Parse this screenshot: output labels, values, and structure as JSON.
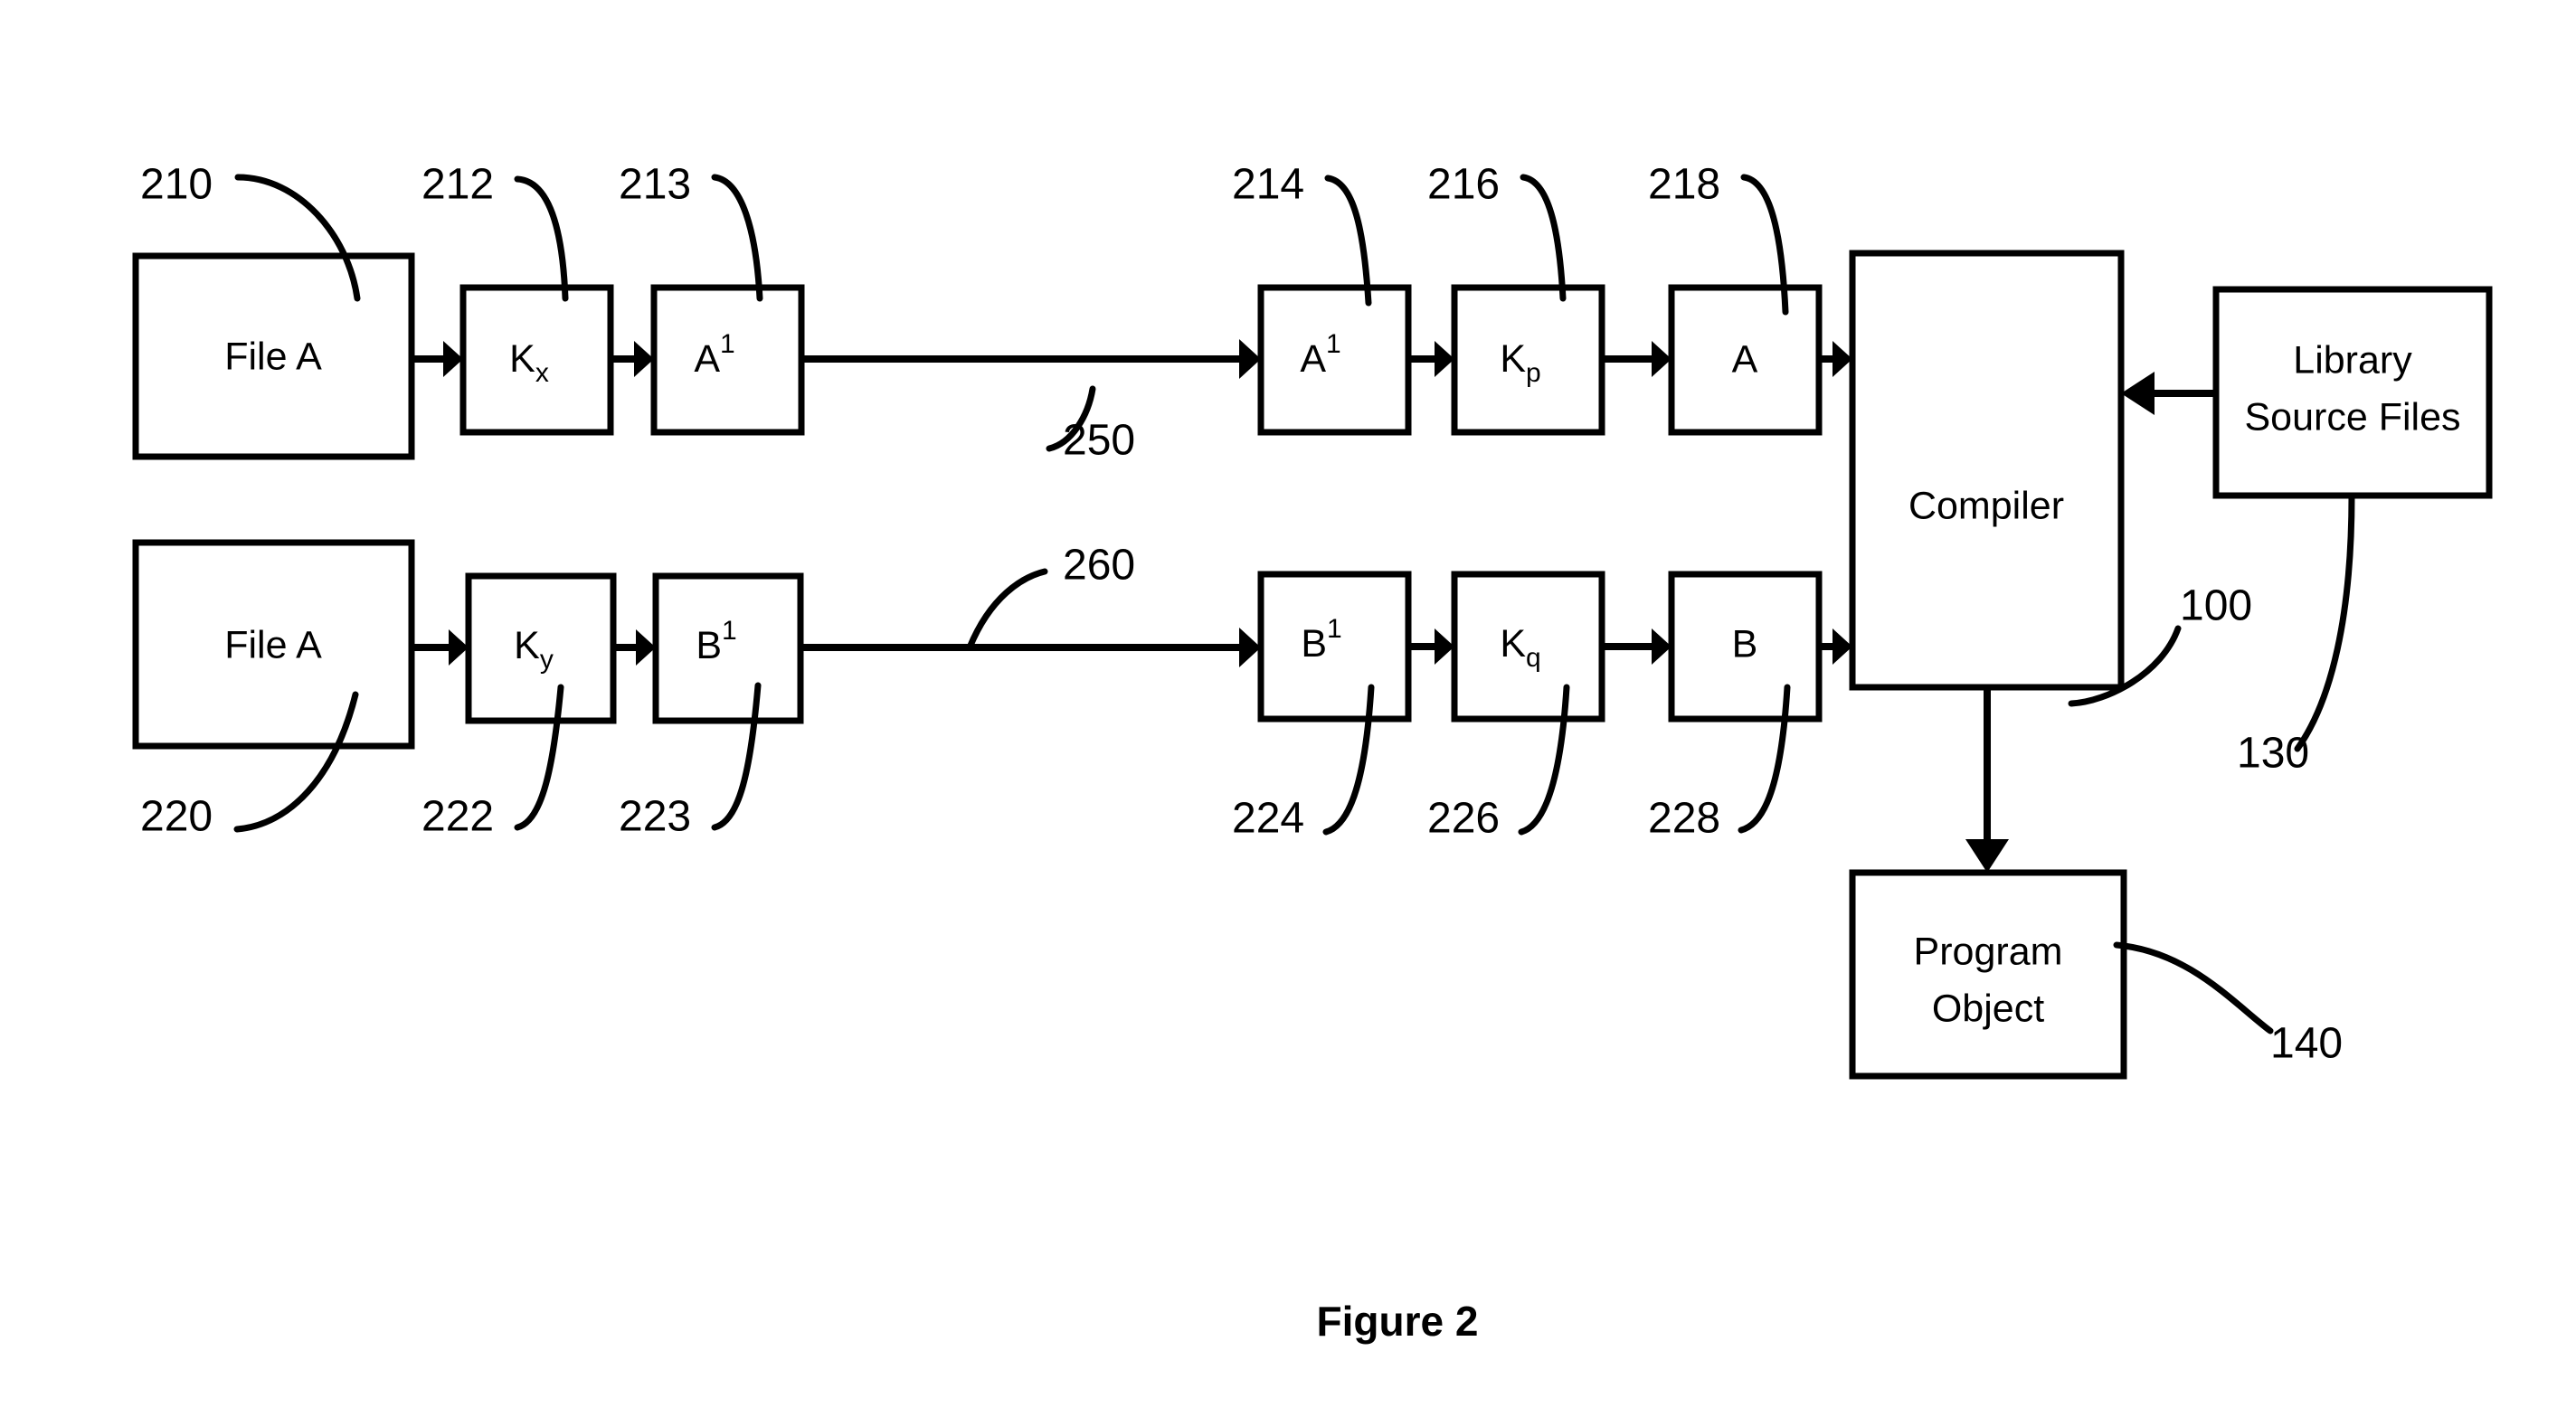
{
  "figure": {
    "caption": "Figure 2",
    "title_number": "2"
  },
  "boxes": {
    "file_a_top": {
      "label": "File A",
      "ref": "210"
    },
    "kx": {
      "label": "K",
      "sub": "x",
      "ref": "212"
    },
    "a1_left": {
      "label": "A",
      "sup": "1",
      "ref": "213"
    },
    "a1_right": {
      "label": "A",
      "sup": "1",
      "ref": "214"
    },
    "kp": {
      "label": "K",
      "sub": "p",
      "ref": "216"
    },
    "a_plain": {
      "label": "A",
      "ref": "218"
    },
    "file_a_bottom": {
      "label": "File A",
      "ref": "220"
    },
    "ky": {
      "label": "K",
      "sub": "y",
      "ref": "222"
    },
    "b1_left": {
      "label": "B",
      "sup": "1",
      "ref": "223"
    },
    "b1_right": {
      "label": "B",
      "sup": "1",
      "ref": "224"
    },
    "kq": {
      "label": "K",
      "sub": "q",
      "ref": "226"
    },
    "b_plain": {
      "label": "B",
      "ref": "228"
    },
    "compiler": {
      "label": "Compiler",
      "ref": "100"
    },
    "library_source_files": {
      "label_line1": "Library",
      "label_line2": "Source Files",
      "ref": "130"
    },
    "program_object": {
      "label_line1": "Program",
      "label_line2": "Object",
      "ref": "140"
    }
  },
  "connectors": {
    "top_transport": {
      "ref": "250"
    },
    "bottom_transport": {
      "ref": "260"
    }
  },
  "refs": {
    "r210": "210",
    "r212": "212",
    "r213": "213",
    "r214": "214",
    "r216": "216",
    "r218": "218",
    "r220": "220",
    "r222": "222",
    "r223": "223",
    "r224": "224",
    "r226": "226",
    "r228": "228",
    "r250": "250",
    "r260": "260",
    "r100": "100",
    "r130": "130",
    "r140": "140"
  },
  "colors": {
    "stroke": "#000000",
    "fill": "#ffffff",
    "background": "#ffffff"
  }
}
